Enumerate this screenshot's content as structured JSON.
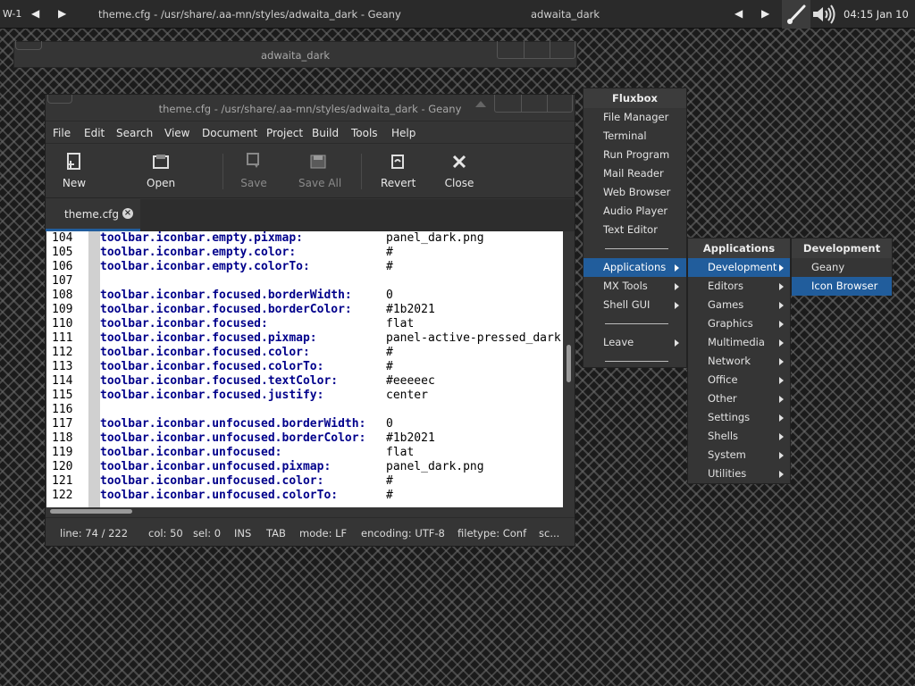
{
  "topbar": {
    "workspace": "W-1",
    "task_title": "theme.cfg - /usr/share/.aa-mn/styles/adwaita_dark - Geany",
    "workspace_name": "adwaita_dark",
    "clock": "04:15  Jan 10"
  },
  "outer_window": {
    "title": "adwaita_dark"
  },
  "geany": {
    "title": "theme.cfg - /usr/share/.aa-mn/styles/adwaita_dark - Geany",
    "menu": [
      "File",
      "Edit",
      "Search",
      "View",
      "Document",
      "Project",
      "Build",
      "Tools",
      "Help"
    ],
    "toolbar": {
      "new": "New",
      "open": "Open",
      "save": "Save",
      "save_all": "Save All",
      "revert": "Revert",
      "close": "Close"
    },
    "tab": {
      "label": "theme.cfg"
    },
    "lines": [
      {
        "n": "104",
        "k": "toolbar.iconbar.empty.pixmap:",
        "v": "panel_dark.png"
      },
      {
        "n": "105",
        "k": "toolbar.iconbar.empty.color:",
        "v": "#"
      },
      {
        "n": "106",
        "k": "toolbar.iconbar.empty.colorTo:",
        "v": "#"
      },
      {
        "n": "107",
        "k": "",
        "v": ""
      },
      {
        "n": "108",
        "k": "toolbar.iconbar.focused.borderWidth:",
        "v": "0"
      },
      {
        "n": "109",
        "k": "toolbar.iconbar.focused.borderColor:",
        "v": "#1b2021"
      },
      {
        "n": "110",
        "k": "toolbar.iconbar.focused:",
        "v": "flat"
      },
      {
        "n": "111",
        "k": "toolbar.iconbar.focused.pixmap:",
        "v": "panel-active-pressed_dark"
      },
      {
        "n": "112",
        "k": "toolbar.iconbar.focused.color:",
        "v": "#"
      },
      {
        "n": "113",
        "k": "toolbar.iconbar.focused.colorTo:",
        "v": "#"
      },
      {
        "n": "114",
        "k": "toolbar.iconbar.focused.textColor:",
        "v": "#eeeeec"
      },
      {
        "n": "115",
        "k": "toolbar.iconbar.focused.justify:",
        "v": "center"
      },
      {
        "n": "116",
        "k": "",
        "v": ""
      },
      {
        "n": "117",
        "k": "toolbar.iconbar.unfocused.borderWidth:",
        "v": "0"
      },
      {
        "n": "118",
        "k": "toolbar.iconbar.unfocused.borderColor:",
        "v": "#1b2021"
      },
      {
        "n": "119",
        "k": "toolbar.iconbar.unfocused:",
        "v": "flat"
      },
      {
        "n": "120",
        "k": "toolbar.iconbar.unfocused.pixmap:",
        "v": "panel_dark.png"
      },
      {
        "n": "121",
        "k": "toolbar.iconbar.unfocused.color:",
        "v": "#"
      },
      {
        "n": "122",
        "k": "toolbar.iconbar.unfocused.colorTo:",
        "v": "#"
      }
    ],
    "status": {
      "line": "line: 74 / 222",
      "col": "col: 50",
      "sel": "sel: 0",
      "ins": "INS",
      "tab": "TAB",
      "mode": "mode: LF",
      "encoding": "encoding: UTF-8",
      "filetype": "filetype: Conf",
      "scope": "sc..."
    }
  },
  "fluxbox_menu": {
    "title": "Fluxbox",
    "items": [
      "File Manager",
      "Terminal",
      "Run Program",
      "Mail Reader",
      "Web Browser",
      "Audio Player",
      "Text Editor"
    ],
    "submenus": [
      "Applications",
      "MX Tools",
      "Shell GUI"
    ],
    "leave": "Leave"
  },
  "applications_menu": {
    "title": "Applications",
    "items": [
      "Development",
      "Editors",
      "Games",
      "Graphics",
      "Multimedia",
      "Network",
      "Office",
      "Other",
      "Settings",
      "Shells",
      "System",
      "Utilities"
    ]
  },
  "development_menu": {
    "title": "Development",
    "items": [
      "Geany",
      "Icon Browser"
    ]
  },
  "colors": {
    "selection": "#215d9c",
    "panel": "#353535",
    "keyword": "#00008b"
  }
}
